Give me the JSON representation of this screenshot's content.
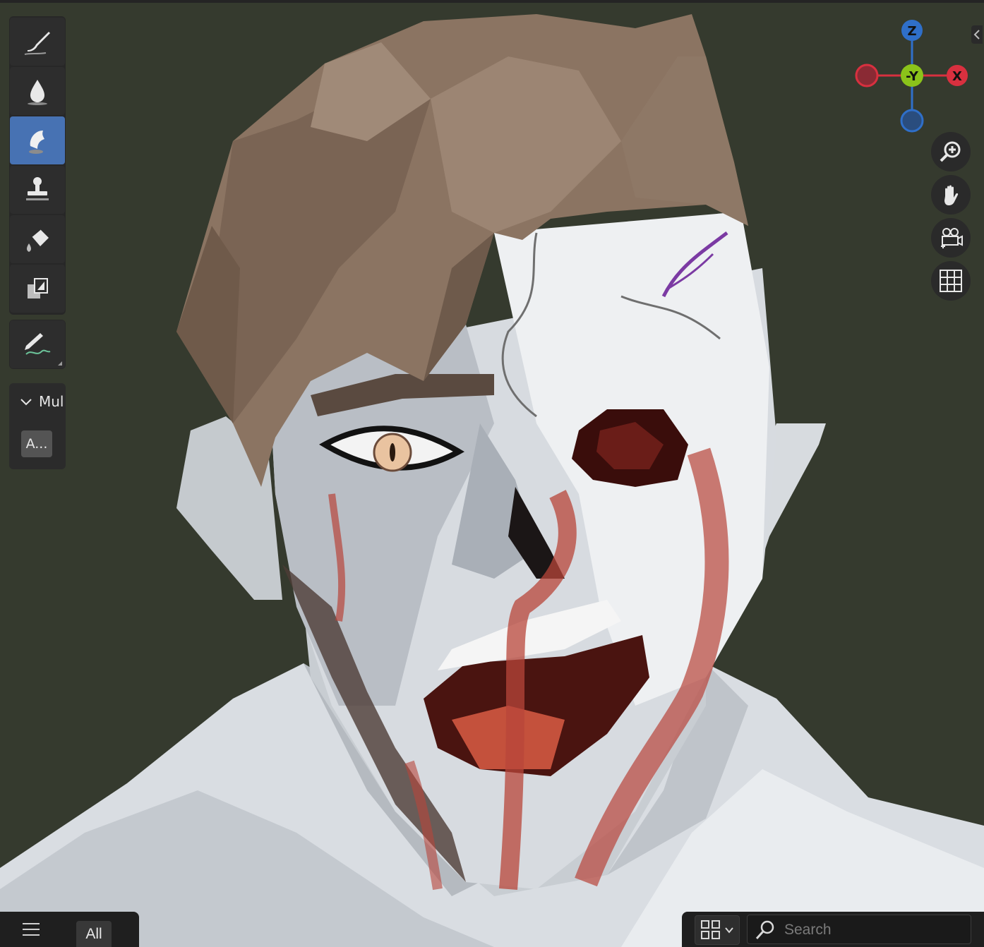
{
  "toolbar": {
    "tools": [
      {
        "icon": "draw-brush-icon",
        "active": false
      },
      {
        "icon": "soften-drop-icon",
        "active": false
      },
      {
        "icon": "smear-icon",
        "active": true
      },
      {
        "icon": "clone-stamp-icon",
        "active": false
      },
      {
        "icon": "fill-bucket-icon",
        "active": false
      },
      {
        "icon": "mask-layers-icon",
        "active": false
      }
    ],
    "annotate_icon": "annotate-pencil-icon"
  },
  "panel": {
    "header_label": "Mul",
    "button_label": "A..."
  },
  "gizmo": {
    "z_label": "Z",
    "y_label": "-Y",
    "x_label": "X",
    "colors": {
      "z": "#2f6fc9",
      "y": "#8bc31a",
      "x": "#d8303f",
      "neg_x": "#8a2a34",
      "neg_z": "#2a4d7e"
    }
  },
  "nav_buttons": [
    "zoom-icon",
    "pan-hand-icon",
    "camera-view-icon",
    "ortho-grid-icon"
  ],
  "bottom_bar": {
    "filter_label": "All",
    "search_placeholder": "Search"
  },
  "colors": {
    "viewport_bg": "#353a2e",
    "active_tool": "#4772b3",
    "toolbar_bg": "#272727"
  }
}
